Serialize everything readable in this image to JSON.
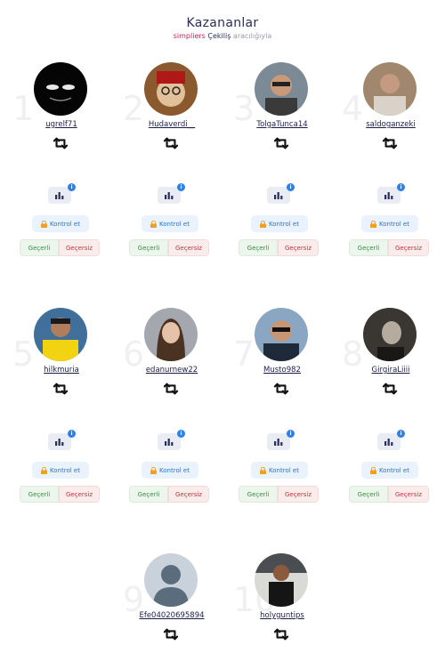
{
  "header": {
    "title": "Kazananlar",
    "subtitle_brand": "simpliers",
    "subtitle_mid": "Çekiliş",
    "subtitle_rest": "aracılığıyla"
  },
  "controls_labels": {
    "info": "i",
    "check": "Kontrol et",
    "valid": "Geçerli",
    "invalid": "Geçersiz"
  },
  "winners": [
    {
      "rank": "1",
      "username": "ugrelf71"
    },
    {
      "rank": "2",
      "username": "Hudaverdi__"
    },
    {
      "rank": "3",
      "username": "TolgaTunca14"
    },
    {
      "rank": "4",
      "username": "saldoganzeki"
    },
    {
      "rank": "5",
      "username": "hilkmuria"
    },
    {
      "rank": "6",
      "username": "edanurnew22"
    },
    {
      "rank": "7",
      "username": "Musto982"
    },
    {
      "rank": "8",
      "username": "GirgiraLiiii"
    },
    {
      "rank": "9",
      "username": "Efe04020695894"
    },
    {
      "rank": "10",
      "username": "holyguntips"
    }
  ],
  "icons": {
    "retweet": "retweet-icon",
    "stats": "bar-chart-icon",
    "lock": "lock-icon"
  },
  "colors": {
    "title": "#2b2d5c",
    "brand": "#c8205c",
    "info_badge": "#2e80ec",
    "valid": "#3c8c44",
    "invalid": "#b83a3a"
  }
}
